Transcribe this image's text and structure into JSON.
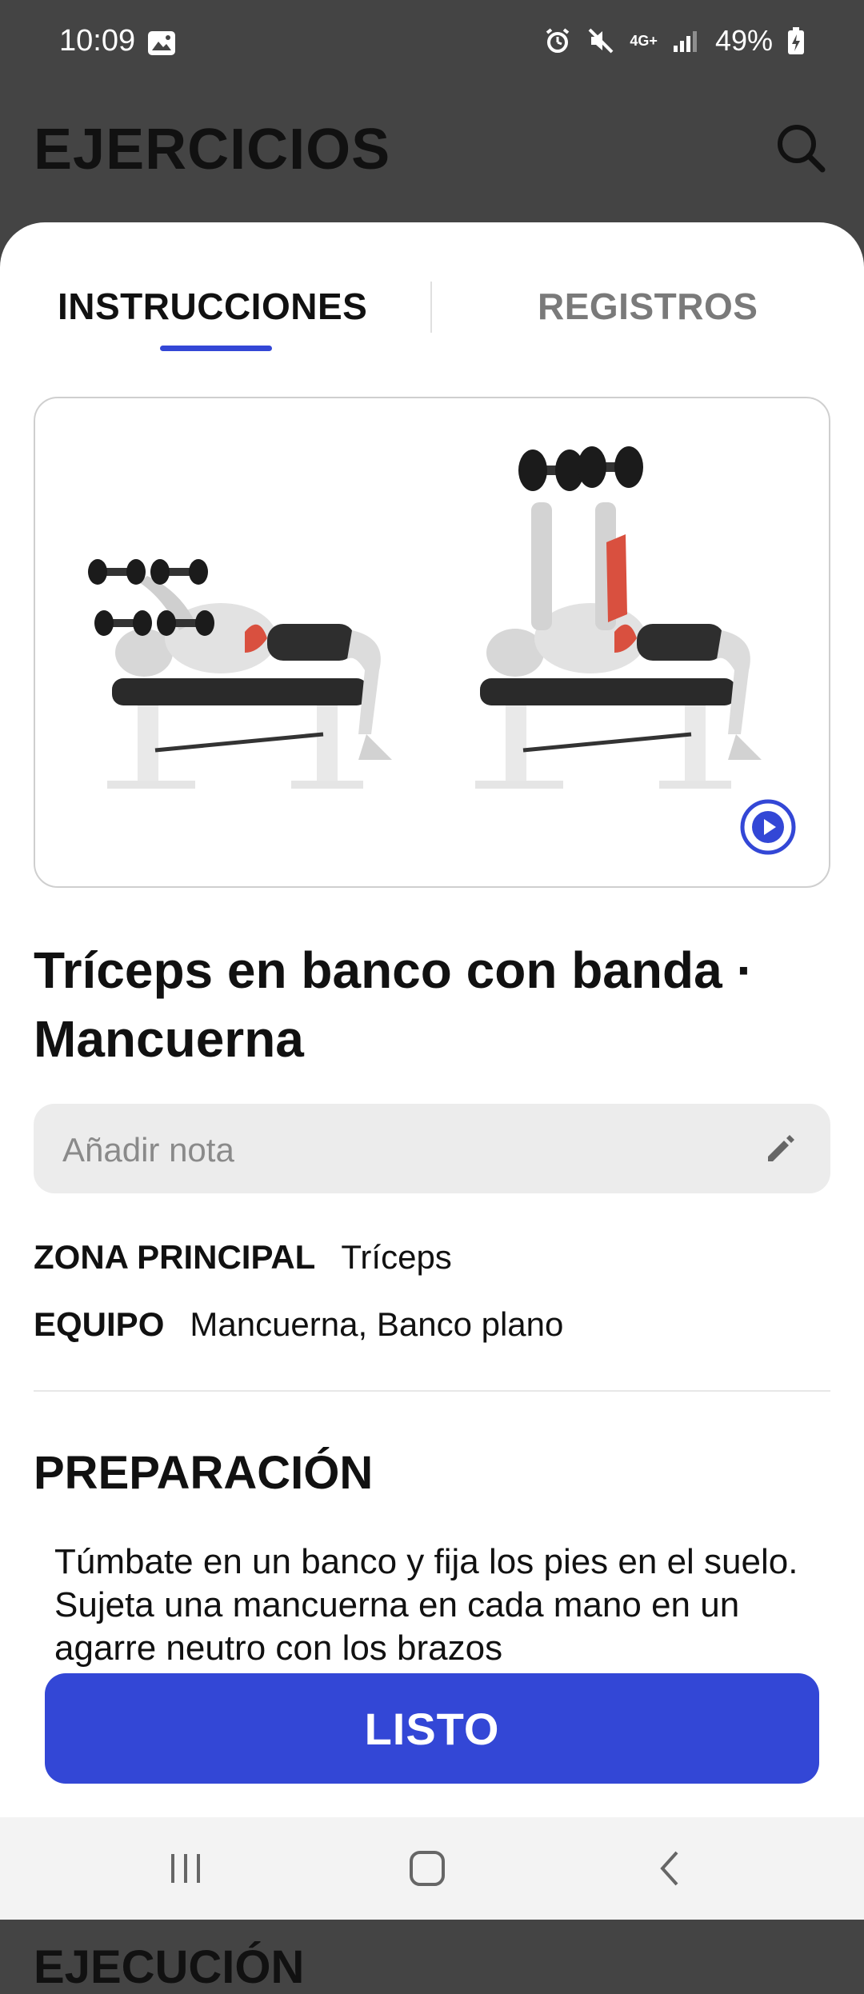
{
  "status": {
    "time": "10:09",
    "battery": "49%",
    "network": "4G+"
  },
  "header": {
    "title": "EJERCICIOS"
  },
  "tabs": [
    {
      "label": "INSTRUCCIONES",
      "active": true
    },
    {
      "label": "REGISTROS",
      "active": false
    }
  ],
  "exercise": {
    "name": "Tríceps en banco con banda · Mancuerna"
  },
  "note": {
    "placeholder": "Añadir nota"
  },
  "info": {
    "zona_label": "ZONA PRINCIPAL",
    "zona_value": "Tríceps",
    "equipo_label": "EQUIPO",
    "equipo_value": "Mancuerna, Banco plano"
  },
  "preparacion": {
    "title": "PREPARACIÓN",
    "text": "Túmbate en un banco y fija los pies en el suelo. Sujeta una mancuerna en cada mano en un agarre neutro con los brazos"
  },
  "ejecucion": {
    "title": "EJECUCIÓN"
  },
  "button": {
    "label": "LISTO"
  },
  "colors": {
    "accent": "#3347d6",
    "header_bg": "#444444"
  },
  "icons": {
    "search": "search-icon",
    "play": "play-icon",
    "edit": "pencil-icon",
    "nav": [
      "recent-apps-icon",
      "home-icon",
      "back-icon"
    ]
  }
}
